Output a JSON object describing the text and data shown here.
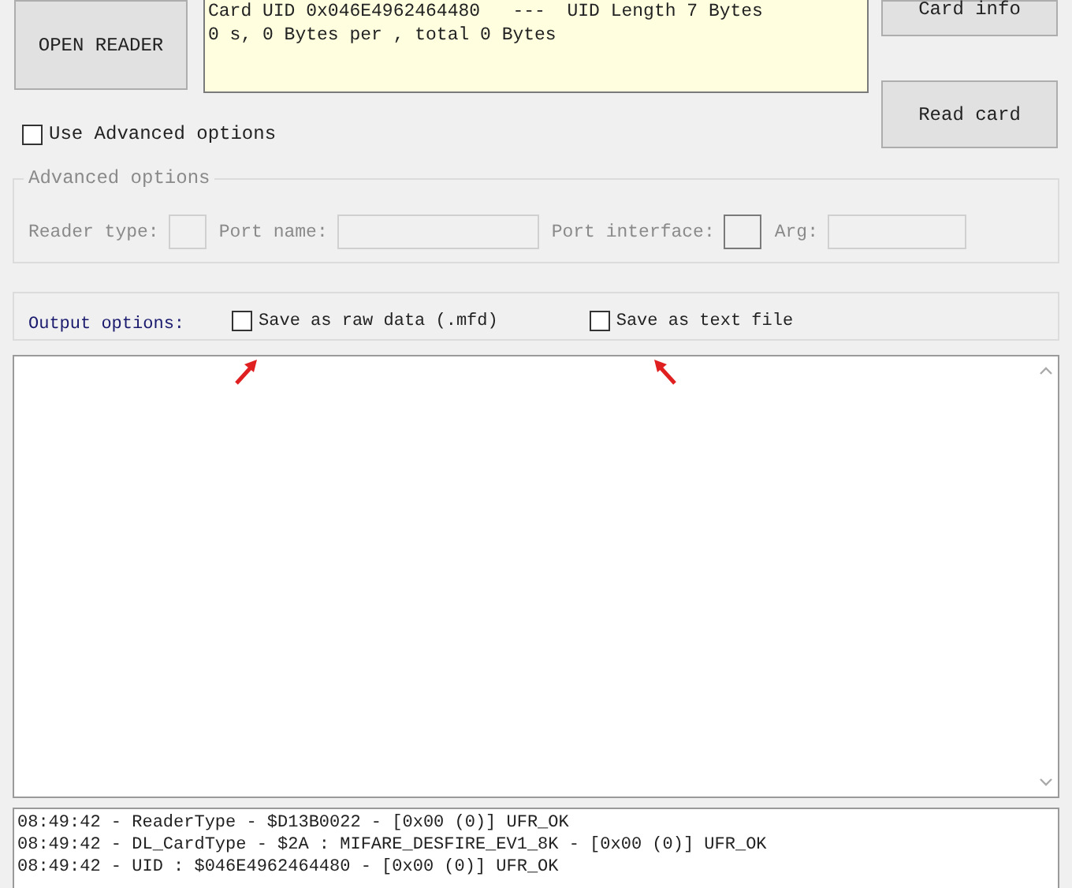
{
  "buttons": {
    "open_reader": "OPEN READER",
    "card_info": "Card info",
    "read_card": "Read card"
  },
  "info_box": {
    "lines": [
      "Card UID 0x046E4962464480   ---  UID Length 7 Bytes",
      "0 s, 0 Bytes per , total 0 Bytes"
    ]
  },
  "advanced_checkbox": {
    "label": "Use Advanced options",
    "checked": false
  },
  "advanced_group": {
    "title": "Advanced options",
    "disabled": true,
    "fields": [
      {
        "label": "Reader type:",
        "kind": "small",
        "disabled": true
      },
      {
        "label": "Port name:",
        "kind": "wide",
        "disabled": true
      },
      {
        "label": "Port interface:",
        "kind": "small",
        "disabled": false
      },
      {
        "label": "Arg:",
        "kind": "wide",
        "disabled": true
      }
    ]
  },
  "output_options": {
    "label": "Output options:",
    "checkboxes": [
      {
        "label": "Save as raw data (.mfd)",
        "checked": false
      },
      {
        "label": "Save as text file",
        "checked": false
      }
    ]
  },
  "log": {
    "lines": [
      "08:49:42 - ReaderType - $D13B0022 - [0x00 (0)] UFR_OK",
      "08:49:42 - DL_CardType - $2A : MIFARE_DESFIRE_EV1_8K - [0x00 (0)] UFR_OK",
      "08:49:42 - UID : $046E4962464480 - [0x00 (0)] UFR_OK"
    ]
  }
}
